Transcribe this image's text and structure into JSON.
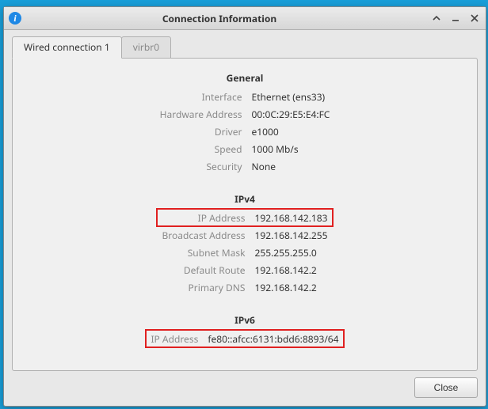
{
  "window": {
    "title": "Connection Information",
    "icon_letter": "i"
  },
  "tabs": [
    {
      "label": "Wired connection 1",
      "active": true
    },
    {
      "label": "virbr0",
      "active": false
    }
  ],
  "sections": {
    "general": {
      "title": "General",
      "rows": [
        {
          "label": "Interface",
          "value": "Ethernet (ens33)"
        },
        {
          "label": "Hardware Address",
          "value": "00:0C:29:E5:E4:FC"
        },
        {
          "label": "Driver",
          "value": "e1000"
        },
        {
          "label": "Speed",
          "value": "1000 Mb/s"
        },
        {
          "label": "Security",
          "value": "None"
        }
      ]
    },
    "ipv4": {
      "title": "IPv4",
      "rows": [
        {
          "label": "IP Address",
          "value": "192.168.142.183",
          "highlight": true
        },
        {
          "label": "Broadcast Address",
          "value": "192.168.142.255"
        },
        {
          "label": "Subnet Mask",
          "value": "255.255.255.0"
        },
        {
          "label": "Default Route",
          "value": "192.168.142.2"
        },
        {
          "label": "Primary DNS",
          "value": "192.168.142.2"
        }
      ]
    },
    "ipv6": {
      "title": "IPv6",
      "rows": [
        {
          "label": "IP Address",
          "value": "fe80::afcc:6131:bdd6:8893/64",
          "highlight": true
        }
      ]
    }
  },
  "buttons": {
    "close": "Close"
  }
}
